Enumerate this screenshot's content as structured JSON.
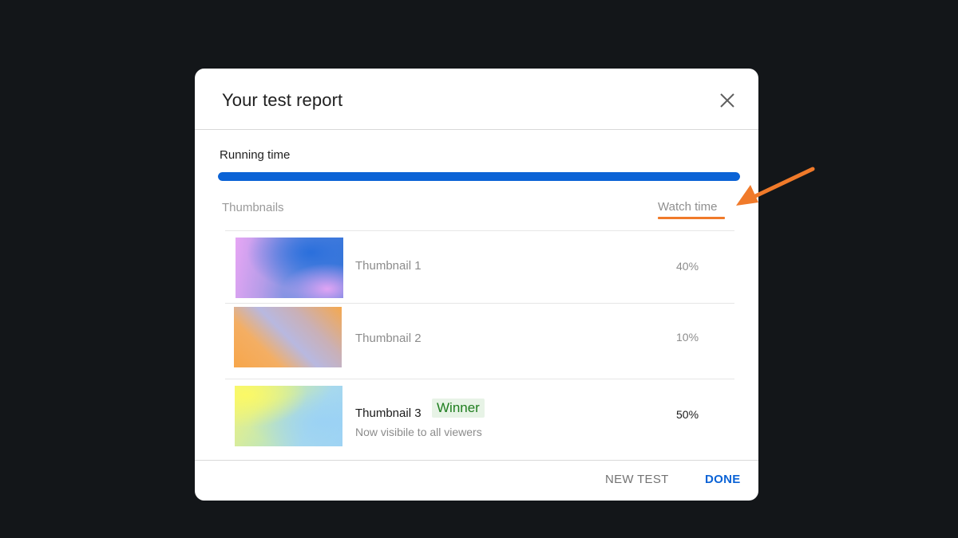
{
  "dialog": {
    "title": "Your test report",
    "close_icon": "close-icon"
  },
  "running": {
    "label": "Running time",
    "progress": 1.0,
    "bar_color": "#0b63d6"
  },
  "table": {
    "col_thumbnails": "Thumbnails",
    "col_watch_time": "Watch time",
    "rows": [
      {
        "name": "Thumbnail 1",
        "value": "40%"
      },
      {
        "name": "Thumbnail 2",
        "value": "10%"
      },
      {
        "name": "Thumbnail 3",
        "value": "50%",
        "badge": "Winner",
        "subtext": "Now visibile to all viewers"
      }
    ]
  },
  "footer": {
    "new_test_label": "NEW TEST",
    "done_label": "DONE"
  },
  "colors": {
    "accent_blue": "#0b63d6",
    "annotation_orange": "#f07a2a",
    "winner_green": "#1e7d1e",
    "backdrop": "#131619"
  },
  "annotation": {
    "icon": "arrow-icon"
  }
}
